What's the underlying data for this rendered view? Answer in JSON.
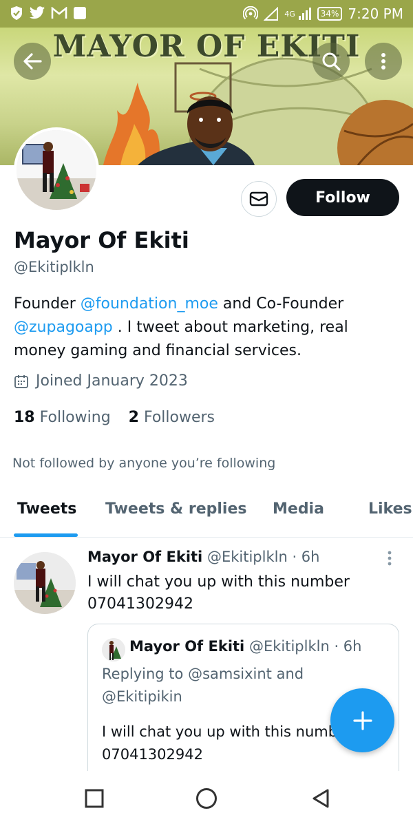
{
  "status_bar": {
    "battery": "34%",
    "time": "7:20 PM",
    "network": "4G"
  },
  "banner": {
    "title": "MAYOR OF EKITI"
  },
  "profile": {
    "name": "Mayor Of Ekiti",
    "handle": "@Ekitiplkln",
    "follow_label": "Follow",
    "bio": {
      "part1": "Founder ",
      "mention1": "@foundation_moe",
      "part2": "  and Co-Founder ",
      "mention2": "@zupagoapp",
      "part3": " . I tweet about marketing, real money gaming and financial services."
    },
    "joined": "Joined January 2023",
    "following_count": "18",
    "following_label": "Following",
    "followers_count": "2",
    "followers_label": "Followers",
    "not_followed": "Not followed by anyone you’re following"
  },
  "tabs": [
    {
      "label": "Tweets"
    },
    {
      "label": "Tweets & replies"
    },
    {
      "label": "Media"
    },
    {
      "label": "Likes"
    }
  ],
  "tweet": {
    "name": "Mayor Of Ekiti",
    "handle": "@Ekitiplkln",
    "time": "· 6h",
    "text": "I will chat you up with this number 07041302942",
    "quote": {
      "name": "Mayor Of Ekiti",
      "handle": "@Ekitiplkln",
      "time": "· 6h",
      "replying": "Replying to @samsixint and @Ekitipikin",
      "text": "I will chat you up with this number 07041302942"
    }
  },
  "colors": {
    "accent": "#1d9bf0",
    "primary_text": "#0f1419",
    "secondary_text": "#536471",
    "status_bar": "#9aa64a"
  }
}
